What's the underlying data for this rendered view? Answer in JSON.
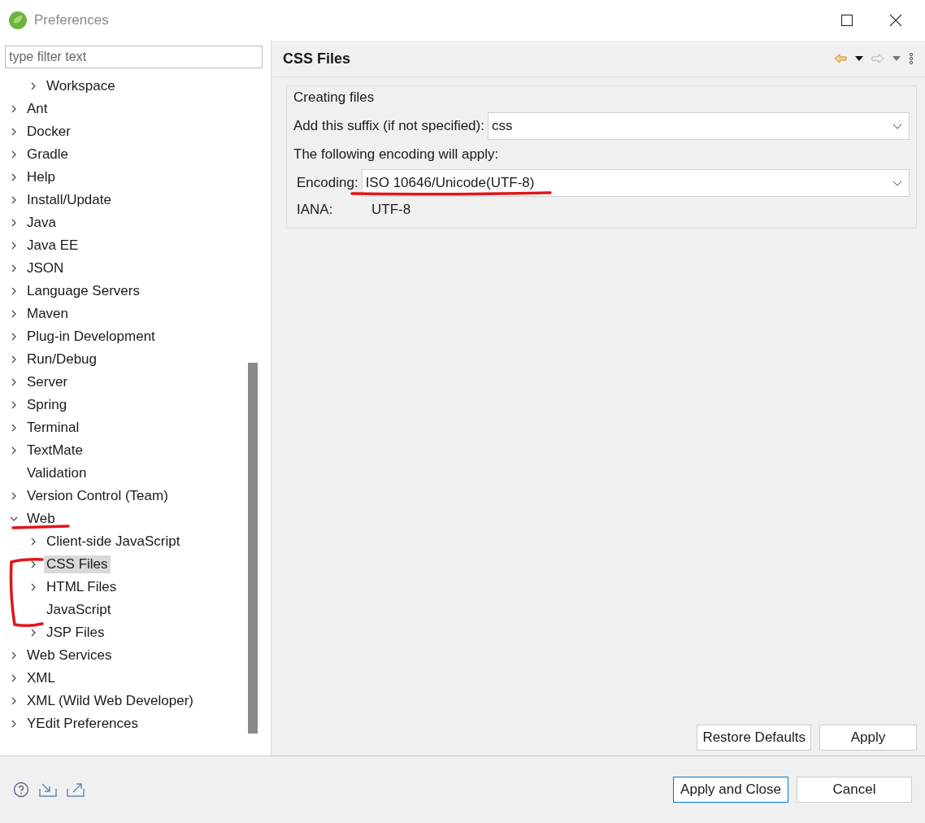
{
  "window": {
    "title": "Preferences"
  },
  "filter": {
    "placeholder": "type filter text"
  },
  "tree": [
    {
      "children": [
        {
          "label": "Workspace",
          "expandable": true,
          "selected": false
        }
      ]
    },
    {
      "label": "Ant",
      "expandable": true,
      "selected": false
    },
    {
      "label": "Docker",
      "expandable": true,
      "selected": false
    },
    {
      "label": "Gradle",
      "expandable": true,
      "selected": false
    },
    {
      "label": "Help",
      "expandable": true,
      "selected": false
    },
    {
      "label": "Install/Update",
      "expandable": true,
      "selected": false
    },
    {
      "label": "Java",
      "expandable": true,
      "selected": false
    },
    {
      "label": "Java EE",
      "expandable": true,
      "selected": false
    },
    {
      "label": "JSON",
      "expandable": true,
      "selected": false
    },
    {
      "label": "Language Servers",
      "expandable": true,
      "selected": false
    },
    {
      "label": "Maven",
      "expandable": true,
      "selected": false
    },
    {
      "label": "Plug-in Development",
      "expandable": true,
      "selected": false
    },
    {
      "label": "Run/Debug",
      "expandable": true,
      "selected": false
    },
    {
      "label": "Server",
      "expandable": true,
      "selected": false
    },
    {
      "label": "Spring",
      "expandable": true,
      "selected": false
    },
    {
      "label": "Terminal",
      "expandable": true,
      "selected": false
    },
    {
      "label": "TextMate",
      "expandable": true,
      "selected": false
    },
    {
      "label": "Validation",
      "expandable": false,
      "selected": false
    },
    {
      "label": "Version Control (Team)",
      "expandable": true,
      "selected": false
    },
    {
      "label": "Web",
      "expandable": true,
      "expanded": true,
      "selected": false,
      "children": [
        {
          "label": "Client-side JavaScript",
          "expandable": true,
          "selected": false
        },
        {
          "label": "CSS Files",
          "expandable": true,
          "selected": true
        },
        {
          "label": "HTML Files",
          "expandable": true,
          "selected": false
        },
        {
          "label": "JavaScript",
          "expandable": false,
          "selected": false
        },
        {
          "label": "JSP Files",
          "expandable": true,
          "selected": false
        }
      ]
    },
    {
      "label": "Web Services",
      "expandable": true,
      "selected": false
    },
    {
      "label": "XML",
      "expandable": true,
      "selected": false
    },
    {
      "label": "XML (Wild Web Developer)",
      "expandable": true,
      "selected": false
    },
    {
      "label": "YEdit Preferences",
      "expandable": true,
      "selected": false
    }
  ],
  "page": {
    "title": "CSS Files",
    "group": {
      "title": "Creating files",
      "suffix_label": "Add this suffix (if not specified):",
      "suffix_value": "css",
      "encoding_note": "The following encoding will apply:",
      "encoding_label": "Encoding:",
      "encoding_value": "ISO 10646/Unicode(UTF-8)",
      "iana_label": "IANA:",
      "iana_value": "UTF-8"
    },
    "buttons": [
      "Restore Defaults",
      "Apply"
    ]
  },
  "footer": {
    "buttons": [
      {
        "label": "Apply and Close",
        "default": true
      },
      {
        "label": "Cancel",
        "default": false
      }
    ]
  }
}
